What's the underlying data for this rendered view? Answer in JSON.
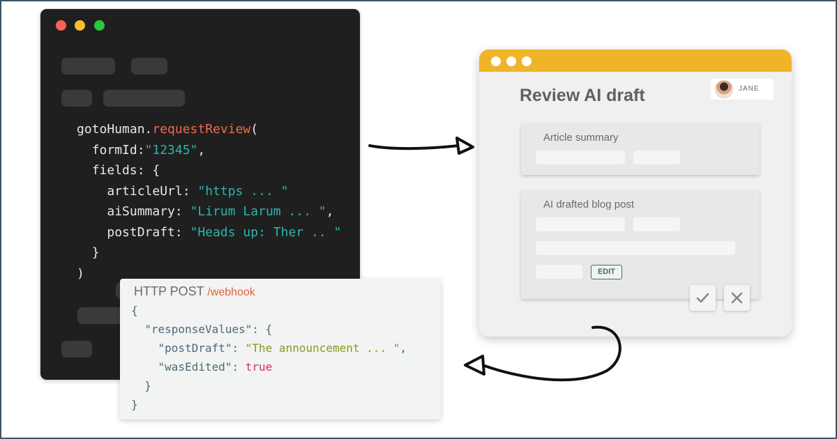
{
  "editor": {
    "code_lines": [
      "gotoHuman.",
      "requestReview",
      "(",
      "formId:",
      "\"12345\"",
      ",",
      "fields: {",
      "articleUrl: ",
      "\"https ... \"",
      "aiSummary: ",
      "\"Lirum Larum ... \"",
      ",",
      "postDraft: ",
      "\"Heads up: Ther .. \"",
      "}",
      ")"
    ]
  },
  "review": {
    "title": "Review AI draft",
    "user": "JANE",
    "cards": [
      {
        "label": "Article summary"
      },
      {
        "label": "AI drafted blog post"
      }
    ],
    "edit_label": "EDIT"
  },
  "payload": {
    "method": "HTTP POST",
    "path": "/webhook",
    "lines": [
      "{",
      "\"responseValues\": {",
      "\"postDraft\": ",
      "\"The announcement ... \"",
      ",",
      "\"wasEdited\": ",
      "true",
      "}",
      "}"
    ]
  }
}
